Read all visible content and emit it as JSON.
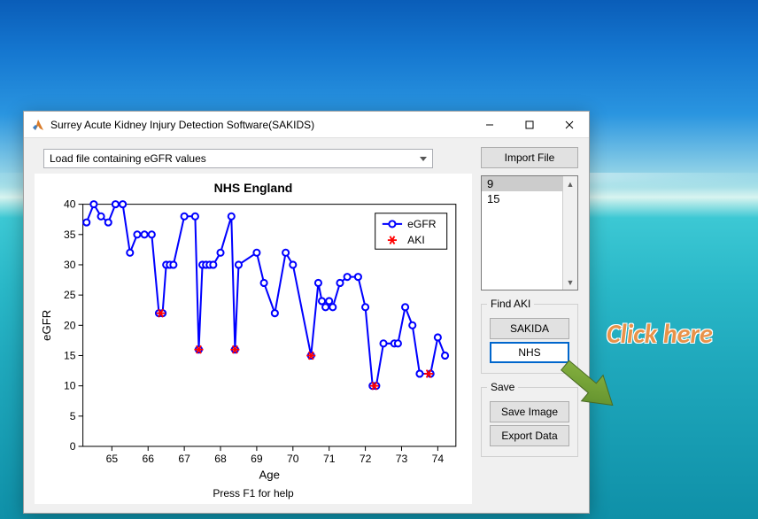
{
  "window": {
    "title": "Surrey Acute Kidney Injury Detection Software(SAKIDS)"
  },
  "dropdown": {
    "value": "Load file containing eGFR values"
  },
  "chart_data": {
    "type": "line",
    "title": "NHS England",
    "xlabel": "Age",
    "ylabel": "eGFR",
    "xlim": [
      64.2,
      74.5
    ],
    "ylim": [
      0,
      40
    ],
    "xticks": [
      65,
      66,
      67,
      68,
      69,
      70,
      71,
      72,
      73,
      74
    ],
    "yticks": [
      0,
      5,
      10,
      15,
      20,
      25,
      30,
      35,
      40
    ],
    "series": [
      {
        "name": "eGFR",
        "color": "#0000ff",
        "marker": "circle",
        "x": [
          64.3,
          64.5,
          64.7,
          64.9,
          65.1,
          65.3,
          65.5,
          65.7,
          65.9,
          66.1,
          66.3,
          66.4,
          66.5,
          66.6,
          66.7,
          67.0,
          67.3,
          67.4,
          67.5,
          67.6,
          67.7,
          67.8,
          68.0,
          68.3,
          68.4,
          68.5,
          69.0,
          69.2,
          69.5,
          69.8,
          70.0,
          70.5,
          70.7,
          70.8,
          70.9,
          71.0,
          71.1,
          71.3,
          71.5,
          71.8,
          72.0,
          72.2,
          72.3,
          72.5,
          72.8,
          72.9,
          73.1,
          73.3,
          73.5,
          73.8,
          74.0,
          74.2
        ],
        "y": [
          37,
          40,
          38,
          37,
          40,
          40,
          32,
          35,
          35,
          35,
          22,
          22,
          30,
          30,
          30,
          38,
          38,
          16,
          30,
          30,
          30,
          30,
          32,
          38,
          16,
          30,
          32,
          27,
          22,
          32,
          30,
          15,
          27,
          24,
          23,
          24,
          23,
          27,
          28,
          28,
          23,
          10,
          10,
          17,
          17,
          17,
          23,
          20,
          12,
          12,
          18,
          15
        ]
      },
      {
        "name": "AKI",
        "color": "#ff0000",
        "marker": "asterisk",
        "x": [
          66.35,
          67.4,
          68.4,
          70.5,
          72.25,
          73.75
        ],
        "y": [
          22,
          16,
          16,
          15,
          10,
          12
        ]
      }
    ],
    "legend": {
      "entries": [
        "eGFR",
        "AKI"
      ],
      "position": "upper-right"
    }
  },
  "footer": {
    "help": "Press F1 for help"
  },
  "buttons": {
    "import": "Import File",
    "sakida": "SAKIDA",
    "nhs": "NHS",
    "save_image": "Save Image",
    "export_data": "Export Data"
  },
  "listbox": {
    "items": [
      "9",
      "15"
    ],
    "selected": 0
  },
  "groups": {
    "find_aki": "Find AKI",
    "save": "Save"
  },
  "annotation": {
    "text": "Click here"
  }
}
